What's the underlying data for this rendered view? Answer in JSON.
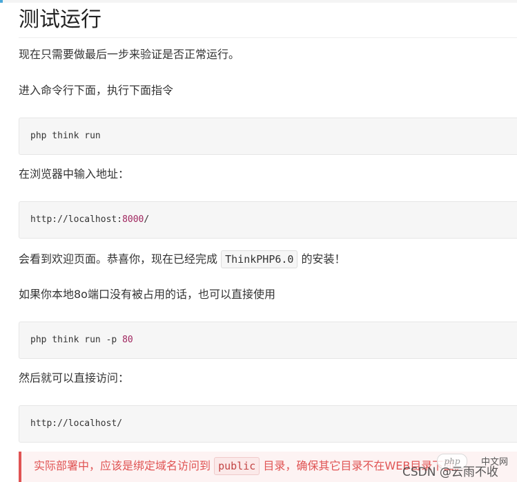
{
  "title": "测试运行",
  "paragraphs": {
    "p1": "现在只需要做最后一步来验证是否正常运行。",
    "p2": "进入命令行下面，执行下面指令",
    "p3": "在浏览器中输入地址：",
    "p4_before": "会看到欢迎页面。恭喜你，现在已经完成",
    "p4_code": "ThinkPHP6.0",
    "p4_after": "的安装！",
    "p5": "如果你本地8o端口没有被占用的话，也可以直接使用",
    "p6": "然后就可以直接访问："
  },
  "code_blocks": {
    "c1": "php think run",
    "c2_prefix": "http://localhost:",
    "c2_port": "8000",
    "c2_suffix": "/",
    "c3_prefix": "php think run ",
    "c3_flag": "-p ",
    "c3_port": "80",
    "c4": "http://localhost/"
  },
  "warning": {
    "before": "实际部署中，应该是绑定域名访问到",
    "code": "public",
    "after": "目录，确保其它目录不在WEB目录下面。"
  },
  "watermark": {
    "php": "php",
    "cn": "中文网",
    "csdn": "CSDN @云雨不收"
  },
  "colors": {
    "accent": "#4aa8d8",
    "number": "#a0265f",
    "warning": "#e05353"
  }
}
